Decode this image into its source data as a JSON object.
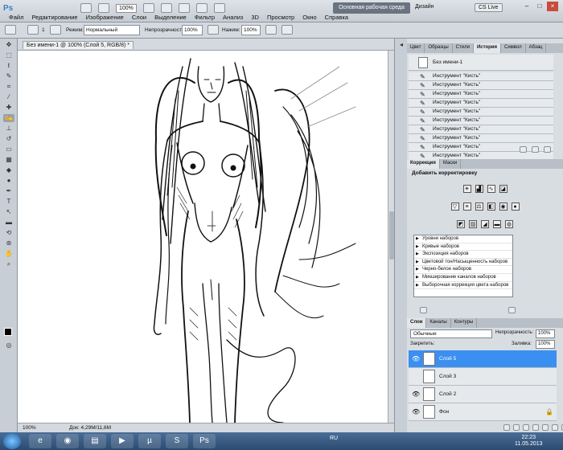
{
  "app": {
    "logo": "Ps",
    "menu": [
      "Файл",
      "Редактирование",
      "Изображение",
      "Слои",
      "Выделение",
      "Фильтр",
      "Анализ",
      "3D",
      "Просмотр",
      "Окно",
      "Справка"
    ],
    "zoom": "100%",
    "workspace": "Основная рабочая среда",
    "design": "Дизайн",
    "cs_live": "CS Live"
  },
  "options": {
    "brush_size": "1",
    "mode_label": "Режим:",
    "mode_value": "Нормальный",
    "opacity_label": "Непрозрачность:",
    "opacity_value": "100%",
    "pressure_label": "Нажим:",
    "pressure_value": "100%"
  },
  "document": {
    "tab": "Без имени-1 @ 100% (Слой 5, RGB/8) *",
    "status_zoom": "100%",
    "status_doc": "Док: 4,29M/11,6M"
  },
  "history_panel": {
    "tabs": [
      "Цвет",
      "Образцы",
      "Стили",
      "История",
      "Символ",
      "Абзац"
    ],
    "active_tab": "История",
    "snapshot": "Без имени-1",
    "items": [
      "Инструмент \"Кисть\"",
      "Инструмент \"Кисть\"",
      "Инструмент \"Кисть\"",
      "Инструмент \"Кисть\"",
      "Инструмент \"Кисть\"",
      "Инструмент \"Кисть\"",
      "Инструмент \"Кисть\"",
      "Инструмент \"Кисть\"",
      "Инструмент \"Кисть\"",
      "Инструмент \"Кисть\""
    ]
  },
  "adjust_panel": {
    "tabs": [
      "Коррекция",
      "Маски"
    ],
    "title": "Добавить корректировку",
    "presets": [
      "Уровни наборов",
      "Кривые наборов",
      "Экспозиция наборов",
      "Цветовой тон/Насыщенность наборов",
      "Черно-белое наборов",
      "Микширование каналов наборов",
      "Выборочная коррекция цвета наборов"
    ]
  },
  "layers_panel": {
    "tabs": [
      "Слои",
      "Каналы",
      "Контуры"
    ],
    "blend_mode": "Обычные",
    "opacity_label": "Непрозрачность:",
    "opacity_value": "100%",
    "lock_label": "Закрепить:",
    "fill_label": "Заливка:",
    "fill_value": "100%",
    "layers": [
      {
        "name": "Слой 5",
        "selected": true,
        "visible": true
      },
      {
        "name": "Слой 3",
        "selected": false,
        "visible": false
      },
      {
        "name": "Слой 2",
        "selected": false,
        "visible": true
      },
      {
        "name": "Фон",
        "selected": false,
        "visible": true
      }
    ]
  },
  "taskbar": {
    "lang": "RU",
    "time": "22:23",
    "date": "11.05.2013"
  },
  "colors": {
    "selection": "#3b8ff0",
    "workspace_btn": "#6a7480"
  }
}
